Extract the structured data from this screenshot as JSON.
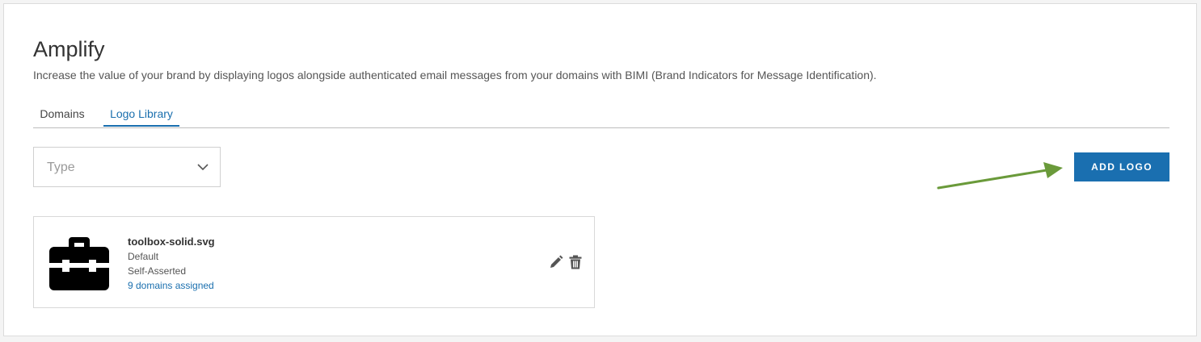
{
  "header": {
    "title": "Amplify",
    "subtitle": "Increase the value of your brand by displaying logos alongside authenticated email messages from your domains with BIMI (Brand Indicators for Message Identification)."
  },
  "tabs": [
    {
      "label": "Domains",
      "active": false
    },
    {
      "label": "Logo Library",
      "active": true
    }
  ],
  "filter": {
    "type_placeholder": "Type"
  },
  "toolbar": {
    "add_logo_label": "ADD LOGO"
  },
  "logos": [
    {
      "icon": "toolbox-icon",
      "name": "toolbox-solid.svg",
      "status": "Default",
      "type": "Self-Asserted",
      "domains_link": "9 domains assigned"
    }
  ],
  "colors": {
    "accent": "#1a6fb0",
    "arrow": "#6a9a3a"
  }
}
